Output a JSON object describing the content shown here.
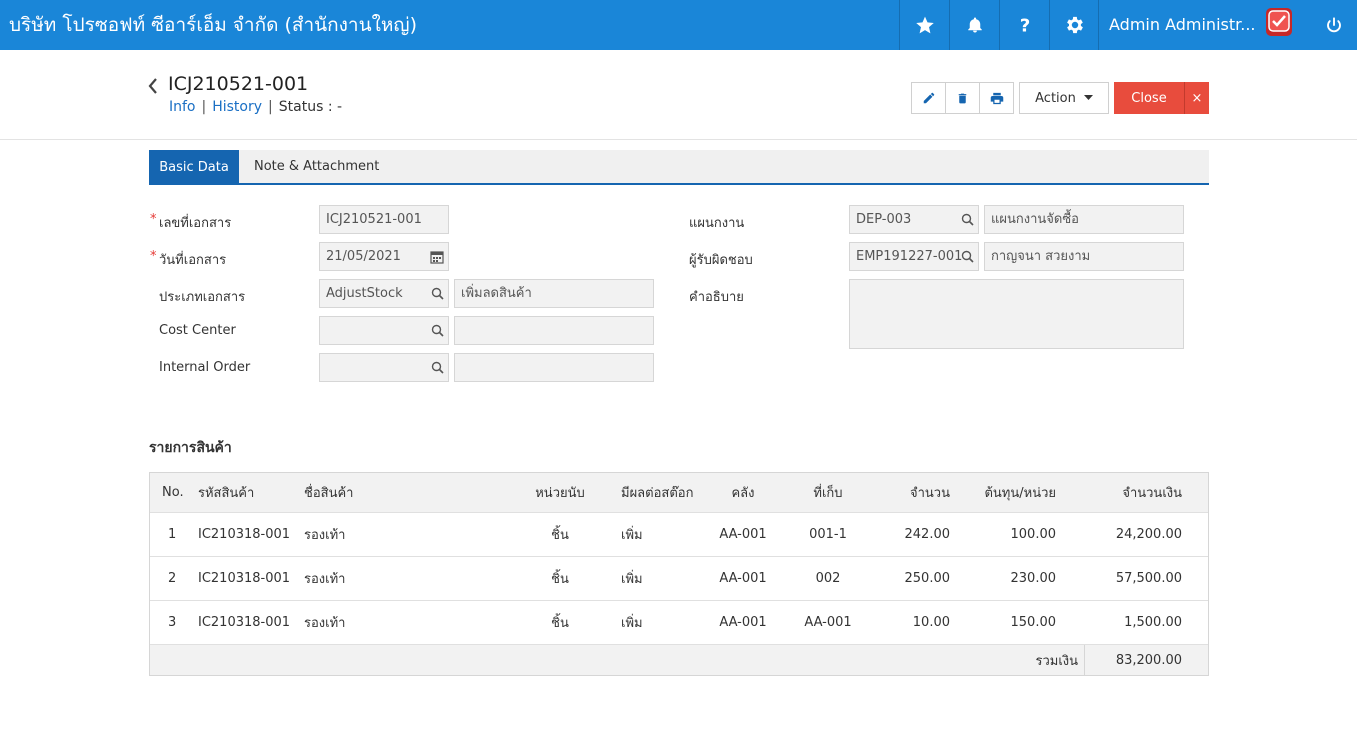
{
  "app": {
    "company": "บริษัท โปรซอฟท์ ซีอาร์เอ็ม จำกัด (สำนักงานใหญ่)",
    "user_name": "Admin Administr...",
    "icons": [
      "star-icon",
      "bell-icon",
      "help-icon",
      "gear-icon",
      "avatar-icon",
      "power-icon"
    ]
  },
  "document": {
    "title": "ICJ210521-001",
    "nav_info": "Info",
    "nav_history": "History",
    "separator": "|",
    "status_label": "Status",
    "status_colon": ":",
    "status_value": "-"
  },
  "toolbar": {
    "action_label": "Action",
    "close_label": "Close",
    "close_x": "×"
  },
  "tabs": {
    "basic": "Basic Data",
    "note": "Note & Attachment"
  },
  "form": {
    "required_mark": "*",
    "doc_no_label": "เลขที่เอกสาร",
    "doc_no_value": "ICJ210521-001",
    "doc_date_label": "วันที่เอกสาร",
    "doc_date_value": "21/05/2021",
    "doc_type_label": "ประเภทเอกสาร",
    "doc_type_code": "AdjustStock",
    "doc_type_name": "เพิ่มลดสินค้า",
    "cost_center_label": "Cost Center",
    "cost_center_code": "",
    "cost_center_name": "",
    "internal_order_label": "Internal Order",
    "internal_order_code": "",
    "internal_order_name": "",
    "department_label": "แผนกงาน",
    "department_code": "DEP-003",
    "department_name": "แผนกงานจัดซื้อ",
    "owner_label": "ผู้รับผิดชอบ",
    "owner_code": "EMP191227-001",
    "owner_name": "กาญจนา สวยงาม",
    "description_label": "คำอธิบาย",
    "description_value": ""
  },
  "items": {
    "section_title": "รายการสินค้า",
    "headers": {
      "no": "No.",
      "code": "รหัสสินค้า",
      "name": "ชื่อสินค้า",
      "unit": "หน่วยนับ",
      "effect": "มีผลต่อสต๊อก",
      "warehouse": "คลัง",
      "location": "ที่เก็บ",
      "qty": "จำนวน",
      "unit_cost": "ต้นทุน/หน่วย",
      "amount": "จำนวนเงิน"
    },
    "rows": [
      {
        "no": "1",
        "code": "IC210318-001",
        "name": "รองเท้า",
        "unit": "ชิ้น",
        "effect": "เพิ่ม",
        "warehouse": "AA-001",
        "location": "001-1",
        "qty": "242.00",
        "unit_cost": "100.00",
        "amount": "24,200.00"
      },
      {
        "no": "2",
        "code": "IC210318-001",
        "name": "รองเท้า",
        "unit": "ชิ้น",
        "effect": "เพิ่ม",
        "warehouse": "AA-001",
        "location": "002",
        "qty": "250.00",
        "unit_cost": "230.00",
        "amount": "57,500.00"
      },
      {
        "no": "3",
        "code": "IC210318-001",
        "name": "รองเท้า",
        "unit": "ชิ้น",
        "effect": "เพิ่ม",
        "warehouse": "AA-001",
        "location": "AA-001",
        "qty": "10.00",
        "unit_cost": "150.00",
        "amount": "1,500.00"
      }
    ],
    "total_label": "รวมเงิน",
    "total_value": "83,200.00"
  },
  "colors": {
    "topbar": "#1a86d8",
    "tab_active": "#1565b0",
    "link": "#1a6fc4",
    "close_button": "#e84c3d",
    "required": "#e53935"
  }
}
